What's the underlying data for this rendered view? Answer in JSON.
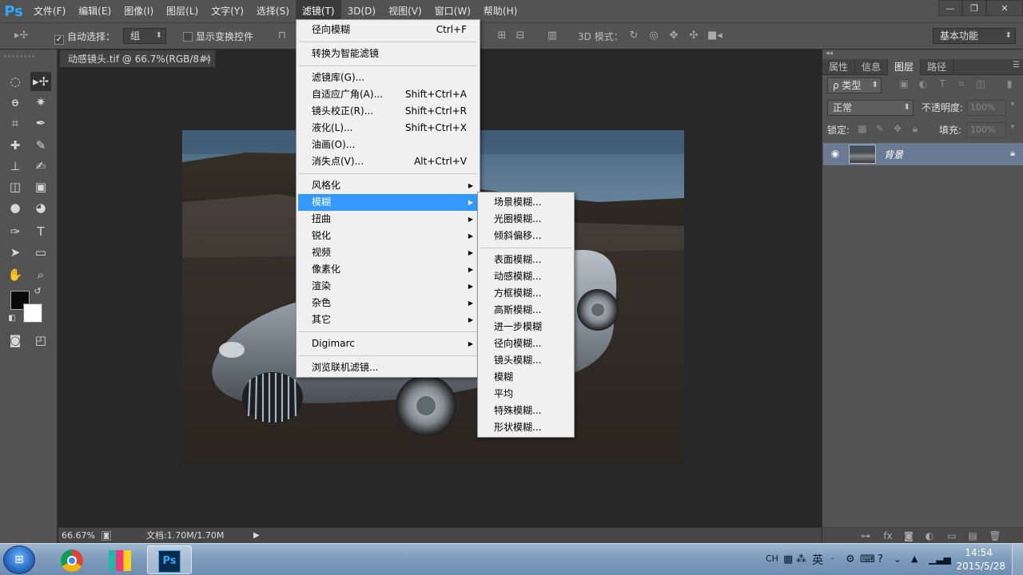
{
  "app": {
    "logo": "Ps"
  },
  "menubar": {
    "items": [
      "文件(F)",
      "编辑(E)",
      "图像(I)",
      "图层(L)",
      "文字(Y)",
      "选择(S)",
      "滤镜(T)",
      "3D(D)",
      "视图(V)",
      "窗口(W)",
      "帮助(H)"
    ],
    "active_index": 6
  },
  "window_controls": {
    "minimize": "—",
    "restore": "❐",
    "close": "✕"
  },
  "options_bar": {
    "auto_select_label": "自动选择：",
    "auto_select_value": "组",
    "show_transform_label": "显示变换控件",
    "mode_3d_label": "3D 模式：",
    "workspace": "基本功能"
  },
  "document": {
    "tab_title": "动感镜头.tif @ 66.7%(RGB/8#)",
    "close_glyph": "×",
    "zoom": "66.67%",
    "doc_info": "文档:1.70M/1.70M"
  },
  "filter_menu": {
    "groups": [
      [
        {
          "label": "径向模糊",
          "shortcut": "Ctrl+F"
        }
      ],
      [
        {
          "label": "转换为智能滤镜",
          "shortcut": ""
        }
      ],
      [
        {
          "label": "滤镜库(G)...",
          "shortcut": ""
        },
        {
          "label": "自适应广角(A)...",
          "shortcut": "Shift+Ctrl+A"
        },
        {
          "label": "镜头校正(R)...",
          "shortcut": "Shift+Ctrl+R"
        },
        {
          "label": "液化(L)...",
          "shortcut": "Shift+Ctrl+X"
        },
        {
          "label": "油画(O)...",
          "shortcut": ""
        },
        {
          "label": "消失点(V)...",
          "shortcut": "Alt+Ctrl+V"
        }
      ],
      [
        {
          "label": "风格化",
          "submenu": true
        },
        {
          "label": "模糊",
          "submenu": true,
          "highlighted": true
        },
        {
          "label": "扭曲",
          "submenu": true
        },
        {
          "label": "锐化",
          "submenu": true
        },
        {
          "label": "视频",
          "submenu": true
        },
        {
          "label": "像素化",
          "submenu": true
        },
        {
          "label": "渲染",
          "submenu": true
        },
        {
          "label": "杂色",
          "submenu": true
        },
        {
          "label": "其它",
          "submenu": true
        }
      ],
      [
        {
          "label": "Digimarc",
          "submenu": true
        }
      ],
      [
        {
          "label": "浏览联机滤镜...",
          "shortcut": ""
        }
      ]
    ]
  },
  "blur_submenu": {
    "groups": [
      [
        "场景模糊...",
        "光圈模糊...",
        "倾斜偏移..."
      ],
      [
        "表面模糊...",
        "动感模糊...",
        "方框模糊...",
        "高斯模糊...",
        "进一步模糊",
        "径向模糊...",
        "镜头模糊...",
        "模糊",
        "平均",
        "特殊模糊...",
        "形状模糊..."
      ]
    ]
  },
  "layers_panel": {
    "tabs": [
      "属性",
      "信息",
      "图层",
      "路径"
    ],
    "active_tab": 2,
    "filter_label": "ρ 类型",
    "blend_mode": "正常",
    "opacity_label": "不透明度:",
    "opacity_value": "100%",
    "lock_label": "锁定:",
    "fill_label": "填充:",
    "fill_value": "100%",
    "layer_name": "背景"
  },
  "taskbar": {
    "ime_lang": "CH",
    "ime_mode": "英",
    "time": "14:54",
    "date": "2015/5/28"
  }
}
